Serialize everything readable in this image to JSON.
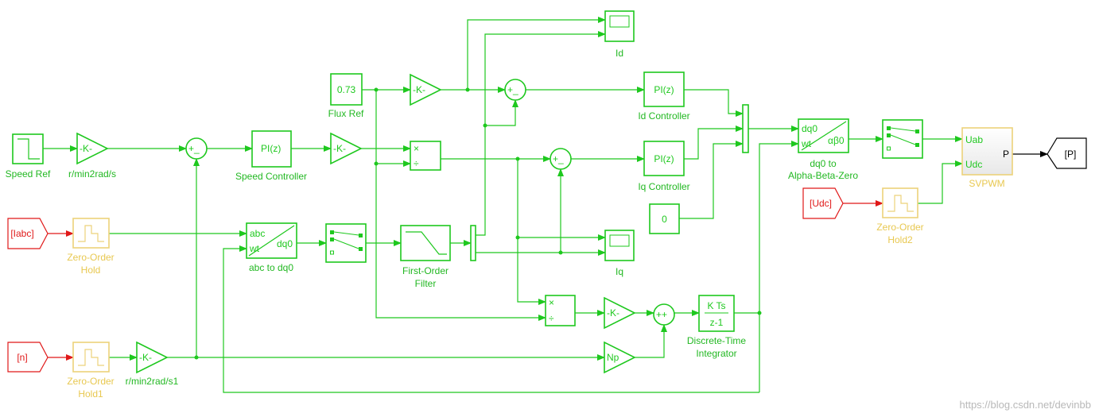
{
  "colors": {
    "signal": "#1ec81e",
    "goto_from": "#e01818",
    "zoh": "#ecd27a",
    "output": "#000000"
  },
  "blocks": {
    "speed_ref": {
      "label": "Speed Ref",
      "icon": "step-icon"
    },
    "gain_speed": {
      "text": "-K-",
      "label": "r/min2rad/s"
    },
    "sum1": {
      "signs": "+_"
    },
    "speed_controller": {
      "text": "PI(z)",
      "label": "Speed Controller"
    },
    "gain_iq": {
      "text": "-K-"
    },
    "flux_ref": {
      "value": "0.73",
      "label": "Flux Ref"
    },
    "gain_id": {
      "text": "-K-"
    },
    "product1": {
      "text_top": "×",
      "text_bottom": "÷"
    },
    "sum_id": {
      "signs": "+_"
    },
    "sum_iq": {
      "signs": "+_"
    },
    "scope_id": {
      "label": "Id"
    },
    "scope_iq": {
      "label": "Iq"
    },
    "id_controller": {
      "text": "PI(z)",
      "label": "Id Controller"
    },
    "iq_controller": {
      "text": "PI(z)",
      "label": "Iq Controller"
    },
    "constant0": {
      "value": "0"
    },
    "dq0_to_abz": {
      "in1": "dq0",
      "in2": "wt",
      "out": "αβ0",
      "label1": "dq0 to",
      "label2": "Alpha-Beta-Zero"
    },
    "svpwm": {
      "in1": "Uab",
      "in2": "Udc",
      "out": "P",
      "label": "SVPWM"
    },
    "goto_p": {
      "text": "[P]"
    },
    "from_udc": {
      "text": "[Udc]"
    },
    "zoh2": {
      "label1": "Zero-Order",
      "label2": "Hold2"
    },
    "from_iabc": {
      "text": "[Iabc]"
    },
    "zoh": {
      "label1": "Zero-Order",
      "label2": "Hold"
    },
    "abc_to_dq0": {
      "in1": "abc",
      "in2": "wt",
      "out": "dq0",
      "label": "abc to dq0"
    },
    "filter": {
      "label1": "First-Order",
      "label2": "Filter"
    },
    "product2": {
      "text_top": "×",
      "text_bottom": "÷"
    },
    "gain_comp": {
      "text": "-K-"
    },
    "sum3": {
      "signs": "++"
    },
    "integrator": {
      "num": "K Ts",
      "den": "z-1",
      "label1": "Discrete-Time",
      "label2": "Integrator"
    },
    "gain_np": {
      "text": "Np"
    },
    "from_n": {
      "text": "[n]"
    },
    "zoh1": {
      "label1": "Zero-Order",
      "label2": "Hold1"
    },
    "gain_speed1": {
      "text": "-K-",
      "label": "r/min2rad/s1"
    }
  },
  "watermark": "https://blog.csdn.net/devinbb"
}
